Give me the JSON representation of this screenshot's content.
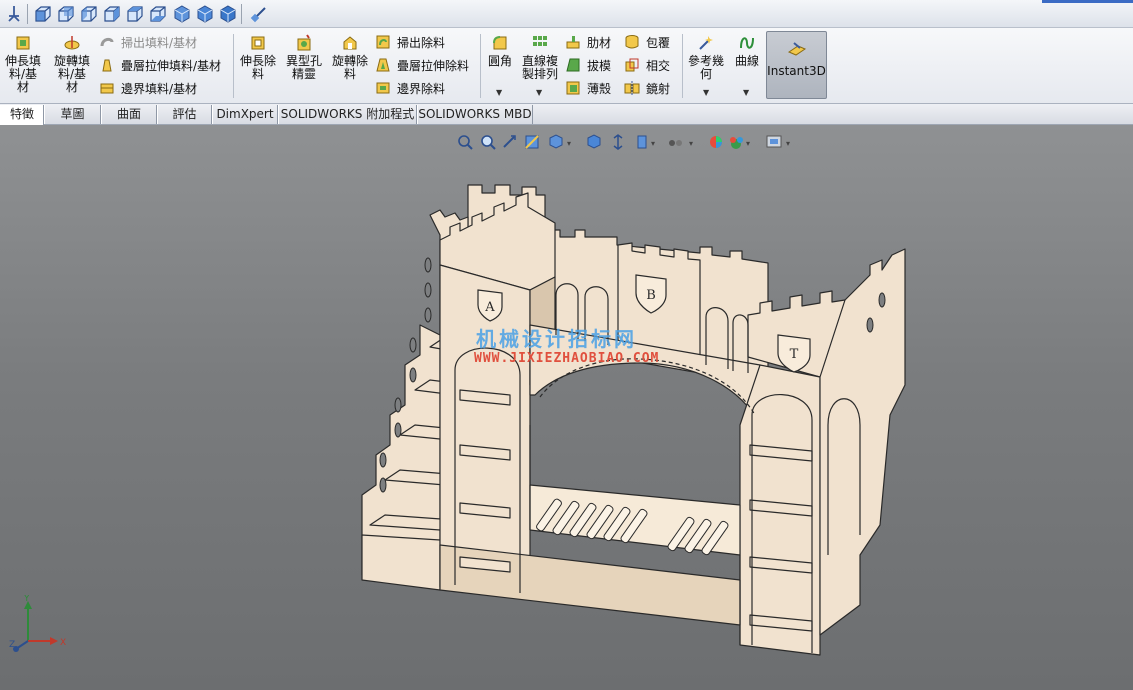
{
  "ribbon": {
    "extrude_boss": "伸長填料/基材",
    "revolve_boss": "旋轉填料/基材",
    "sweep_boss": "掃出填料/基材",
    "loft_boss": "疊層拉伸填料/基材",
    "boundary_boss": "邊界填料/基材",
    "extrude_cut": "伸長除料",
    "hole_wizard": "異型孔精靈",
    "revolve_cut": "旋轉除料",
    "sweep_cut": "掃出除料",
    "loft_cut": "疊層拉伸除料",
    "boundary_cut": "邊界除料",
    "fillet": "圓角",
    "linear_pattern": "直線複製排列",
    "rib": "肋材",
    "draft": "拔模",
    "shell": "薄殼",
    "wrap": "包覆",
    "intersect": "相交",
    "mirror": "鏡射",
    "ref_geometry": "參考幾何",
    "curves": "曲線",
    "instant3d": "Instant3D"
  },
  "tabs": [
    {
      "label": "特徵"
    },
    {
      "label": "草圖"
    },
    {
      "label": "曲面"
    },
    {
      "label": "評估"
    },
    {
      "label": "DimXpert"
    },
    {
      "label": "SOLIDWORKS 附加程式"
    },
    {
      "label": "SOLIDWORKS MBD"
    }
  ],
  "viewport": {
    "watermark_cn": "机械设计招标网",
    "watermark_url": "WWW.JIXIEZHAOBIAO.COM",
    "shield_letters": [
      "A",
      "B",
      "T"
    ],
    "triad": {
      "x": "X",
      "y": "Y",
      "z": "Z"
    }
  },
  "colors": {
    "wood": "#f1e2cf",
    "wood_shade": "#d9c6ad",
    "edge": "#2a2a2a",
    "watermark_blue": "#4aa1e6",
    "watermark_red": "#e0503e"
  }
}
